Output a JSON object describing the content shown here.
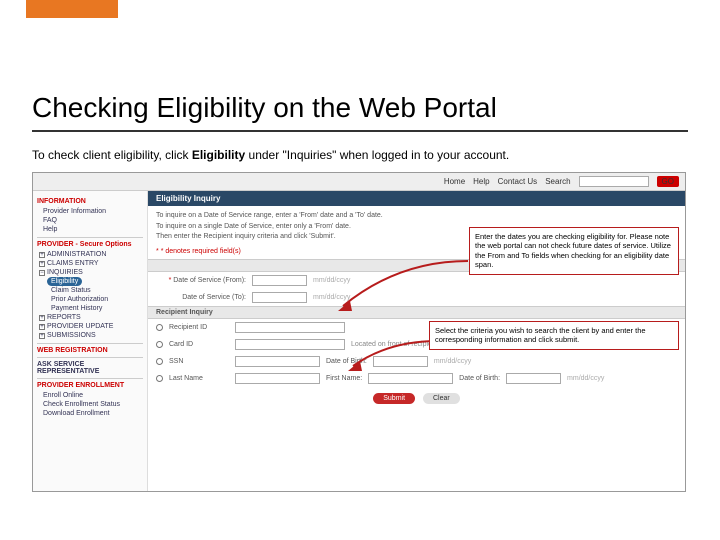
{
  "header": {
    "title": "Checking Eligibility on the Web Portal"
  },
  "desc": {
    "pre": "To check client eligibility, click ",
    "bold": "Eligibility",
    "post": " under \"Inquiries\" when logged in to your account."
  },
  "topnav": {
    "home": "Home",
    "help": "Help",
    "contact": "Contact Us",
    "search": "Search",
    "go": "GO"
  },
  "sidebar": {
    "info_head": "INFORMATION",
    "info_items": [
      "Provider Information",
      "FAQ",
      "Help"
    ],
    "secure_head": "PROVIDER - Secure Options",
    "tree": {
      "admin": "ADMINISTRATION",
      "claims": "CLAIMS ENTRY",
      "inquiries": "INQUIRIES",
      "elig": "Eligibility",
      "claim_status": "Claim Status",
      "prior_auth": "Prior Authorization",
      "payment_hist": "Payment History",
      "reports": "REPORTS",
      "prov_update": "PROVIDER UPDATE",
      "subs": "SUBMISSIONS"
    },
    "webreg_head": "WEB REGISTRATION",
    "ask_head": "ASK SERVICE REPRESENTATIVE",
    "enroll_head": "PROVIDER ENROLLMENT",
    "enroll_items": [
      "Enroll Online",
      "Check Enrollment Status",
      "Download Enrollment"
    ]
  },
  "panel": {
    "title": "Eligibility Inquiry",
    "line1": "To inquire on a Date of Service range, enter a 'From' date and a 'To' date.",
    "line2": "To inquire on a single Date of Service, enter only a 'From' date.",
    "line3": "Then enter the Recipient inquiry criteria and click 'Submit'.",
    "req": "* denotes required field(s)"
  },
  "fields": {
    "dos_from": "Date of Service (From):",
    "dos_to": "Date of Service (To):",
    "ph": "mm/dd/ccyy",
    "recip_hd": "Recipient Inquiry",
    "recip_id": "Recipient ID",
    "card_id": "Card ID",
    "card_hint": "Located on front of recipient's Medicaid card",
    "ssn": "SSN",
    "dob": "Date of Birth:",
    "last": "Last Name",
    "first": "First Name:"
  },
  "buttons": {
    "submit": "Submit",
    "clear": "Clear"
  },
  "callouts": {
    "c1": "Enter the dates you are checking eligibility for. Please note the web portal can not check future dates of service. Utilize the From and To fields when checking for an eligibility date span.",
    "c2": "Select the criteria you wish to search the client by and enter the corresponding information and click submit."
  }
}
